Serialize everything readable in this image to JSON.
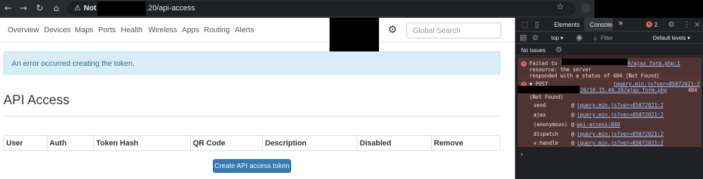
{
  "browser": {
    "back_icon": "←",
    "forward_icon": "→",
    "reload_icon": "↻",
    "home_icon": "⌂",
    "warning_icon": "⚠",
    "not_secure": "Not S",
    "url": ".20/api-access",
    "star_icon": "☆"
  },
  "navbar": {
    "links": [
      "Overview",
      "Devices",
      "Maps",
      "Ports",
      "Health",
      "Wireless",
      "Apps",
      "Routing",
      "Alerts"
    ],
    "gear_icon": "⚙",
    "search_placeholder": "Global Search"
  },
  "alert": {
    "text": "An error occurred creating the token."
  },
  "page": {
    "heading": "API Access",
    "table_headers": [
      "User",
      "Auth",
      "Token Hash",
      "QR Code",
      "Description",
      "Disabled",
      "Remove"
    ],
    "create_button": "Create API access token"
  },
  "devtools": {
    "tabs": {
      "elements": "Elements",
      "console": "Console",
      "more": "»"
    },
    "error_count": "2",
    "context": "top ▾",
    "filter": "Filter",
    "levels": "Default levels ▾",
    "no_issues": "No Issues",
    "log1": {
      "line1_prefix": "Failed to l",
      "line1_link": "0/ajax_form.php:1",
      "line2": "resource: the server",
      "line3": "responded with a status of 404 (Not Found)"
    },
    "log2": {
      "method": "▼ POST",
      "source_link": "jquery.min.js?ver=05072021:2",
      "url_link": "20/10.15.49.20/ajax_form.php",
      "status": "404",
      "status2": "(Not Found)",
      "stack": [
        {
          "fn": "send",
          "loc": "jquery.min.js?ver=05072021:2"
        },
        {
          "fn": "ajax",
          "loc": "jquery.min.js?ver=05072021:2"
        },
        {
          "fn": "(anonymous)",
          "loc": "api-access:840"
        },
        {
          "fn": "dispatch",
          "loc": "jquery.min.js?ver=05072021:2"
        },
        {
          "fn": "v.handle",
          "loc": "jquery.min.js?ver=05072021:2"
        }
      ]
    },
    "prompt": "›"
  },
  "colors": {
    "primary_button": "#337ab7",
    "alert_bg": "#d9edf7",
    "alert_text": "#31708f",
    "console_error_bg": "#4e3534",
    "console_error_icon": "#e46962",
    "console_link": "#a8c7fa"
  }
}
